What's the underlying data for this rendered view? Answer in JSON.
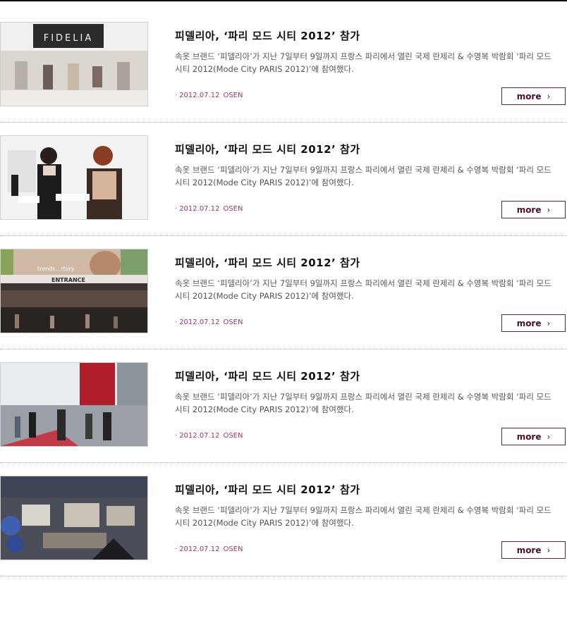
{
  "articles": [
    {
      "title": "피델리아, ‘파리 모드 시티 2012’ 참가",
      "description": "속옷 브랜드 ‘피델리아’가 지난 7일부터 9일까지 프랑스 파리에서 열린 국제 란제리 & 수영복 박람회 ‘파리 모드 시티 2012(Mode City PARIS 2012)’에 참여했다.",
      "date": "2012.07.12",
      "source": "OSEN",
      "more_label": "more",
      "thumb_text": "FIDELIA"
    },
    {
      "title": "피델리아, ‘파리 모드 시티 2012’ 참가",
      "description": "속옷 브랜드 ‘피델리아’가 지난 7일부터 9일까지 프랑스 파리에서 열린 국제 란제리 & 수영복 박람회 ‘파리 모드 시티 2012(Mode City PARIS 2012)’에 참여했다.",
      "date": "2012.07.12",
      "source": "OSEN",
      "more_label": "more"
    },
    {
      "title": "피델리아, ‘파리 모드 시티 2012’ 참가",
      "description": "속옷 브랜드 ‘피델리아’가 지난 7일부터 9일까지 프랑스 파리에서 열린 국제 란제리 & 수영복 박람회 ‘파리 모드 시티 2012(Mode City PARIS 2012)’에 참여했다.",
      "date": "2012.07.12",
      "source": "OSEN",
      "more_label": "more",
      "thumb_text": "ENTRANCE",
      "thumb_text2": "trends...rtory"
    },
    {
      "title": "피델리아, ‘파리 모드 시티 2012’ 참가",
      "description": "속옷 브랜드 ‘피델리아’가 지난 7일부터 9일까지 프랑스 파리에서 열린 국제 란제리 & 수영복 박람회 ‘파리 모드 시티 2012(Mode City PARIS 2012)’에 참여했다.",
      "date": "2012.07.12",
      "source": "OSEN",
      "more_label": "more"
    },
    {
      "title": "피델리아, ‘파리 모드 시티 2012’ 참가",
      "description": "속옷 브랜드 ‘피델리아’가 지난 7일부터 9일까지 프랑스 파리에서 열린 국제 란제리 & 수영복 박람회 ‘파리 모드 시티 2012(Mode City PARIS 2012)’에 참여했다.",
      "date": "2012.07.12",
      "source": "OSEN",
      "more_label": "more"
    }
  ],
  "colors": {
    "accent": "#6d1a44",
    "meta": "#9b3968",
    "divider": "#b5b5b5"
  },
  "icons": {
    "more": "chevron-right-icon",
    "bullet": "bullet-icon"
  }
}
